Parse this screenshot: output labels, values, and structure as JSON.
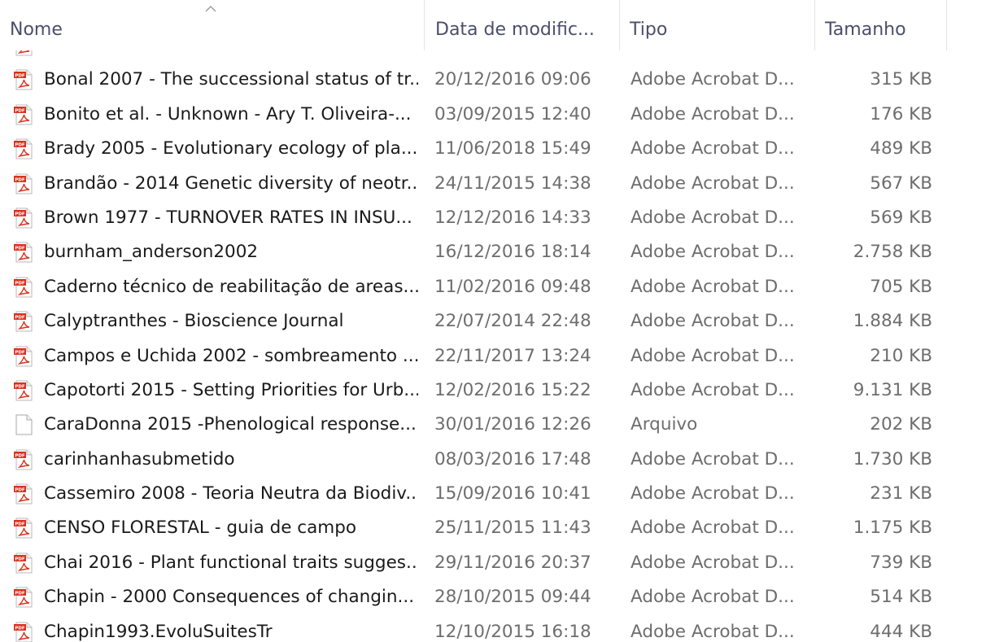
{
  "columns": {
    "name": "Nome",
    "date": "Data de modific...",
    "type": "Tipo",
    "size": "Tamanho"
  },
  "icons": {
    "pdf": "pdf-file-icon",
    "generic": "generic-file-icon",
    "sort": "sort-ascending-icon"
  },
  "colors": {
    "pdf_red": "#d9321f",
    "header_text": "#4b4f6b"
  },
  "files": [
    {
      "name": "",
      "date": "",
      "type": "",
      "size": "",
      "icon": "pdf"
    },
    {
      "name": "Bonal 2007 - The successional status of tr...",
      "date": "20/12/2016 09:06",
      "type": "Adobe Acrobat D...",
      "size": "315 KB",
      "icon": "pdf"
    },
    {
      "name": "Bonito et al. - Unknown - Ary T. Oliveira-...",
      "date": "03/09/2015 12:40",
      "type": "Adobe Acrobat D...",
      "size": "176 KB",
      "icon": "pdf"
    },
    {
      "name": "Brady 2005 - Evolutionary ecology of pla...",
      "date": "11/06/2018 15:49",
      "type": "Adobe Acrobat D...",
      "size": "489 KB",
      "icon": "pdf"
    },
    {
      "name": "Brandão - 2014 Genetic diversity of neotr...",
      "date": "24/11/2015 14:38",
      "type": "Adobe Acrobat D...",
      "size": "567 KB",
      "icon": "pdf"
    },
    {
      "name": "Brown 1977 - TURNOVER RATES IN INSU...",
      "date": "12/12/2016 14:33",
      "type": "Adobe Acrobat D...",
      "size": "569 KB",
      "icon": "pdf"
    },
    {
      "name": "burnham_anderson2002",
      "date": "16/12/2016 18:14",
      "type": "Adobe Acrobat D...",
      "size": "2.758 KB",
      "icon": "pdf"
    },
    {
      "name": "Caderno técnico de reabilitação de areas...",
      "date": "11/02/2016 09:48",
      "type": "Adobe Acrobat D...",
      "size": "705 KB",
      "icon": "pdf"
    },
    {
      "name": "Calyptranthes - Bioscience Journal",
      "date": "22/07/2014 22:48",
      "type": "Adobe Acrobat D...",
      "size": "1.884 KB",
      "icon": "pdf"
    },
    {
      "name": "Campos e Uchida 2002 - sombreamento ...",
      "date": "22/11/2017 13:24",
      "type": "Adobe Acrobat D...",
      "size": "210 KB",
      "icon": "pdf"
    },
    {
      "name": "Capotorti 2015 - Setting Priorities for Urb...",
      "date": "12/02/2016 15:22",
      "type": "Adobe Acrobat D...",
      "size": "9.131 KB",
      "icon": "pdf"
    },
    {
      "name": "CaraDonna 2015 -Phenological response...",
      "date": "30/01/2016 12:26",
      "type": "Arquivo",
      "size": "202 KB",
      "icon": "generic"
    },
    {
      "name": "carinhanhasubmetido",
      "date": "08/03/2016 17:48",
      "type": "Adobe Acrobat D...",
      "size": "1.730 KB",
      "icon": "pdf"
    },
    {
      "name": "Cassemiro 2008 - Teoria Neutra da Biodiv...",
      "date": "15/09/2016 10:41",
      "type": "Adobe Acrobat D...",
      "size": "231 KB",
      "icon": "pdf"
    },
    {
      "name": "CENSO FLORESTAL - guia de campo",
      "date": "25/11/2015 11:43",
      "type": "Adobe Acrobat D...",
      "size": "1.175 KB",
      "icon": "pdf"
    },
    {
      "name": "Chai 2016 - Plant functional traits sugges...",
      "date": "29/11/2016 20:37",
      "type": "Adobe Acrobat D...",
      "size": "739 KB",
      "icon": "pdf"
    },
    {
      "name": "Chapin - 2000 Consequences of changin...",
      "date": "28/10/2015 09:44",
      "type": "Adobe Acrobat D...",
      "size": "514 KB",
      "icon": "pdf"
    },
    {
      "name": "Chapin1993.EvoluSuitesTr",
      "date": "12/10/2015 16:18",
      "type": "Adobe Acrobat D...",
      "size": "444 KB",
      "icon": "pdf"
    }
  ]
}
